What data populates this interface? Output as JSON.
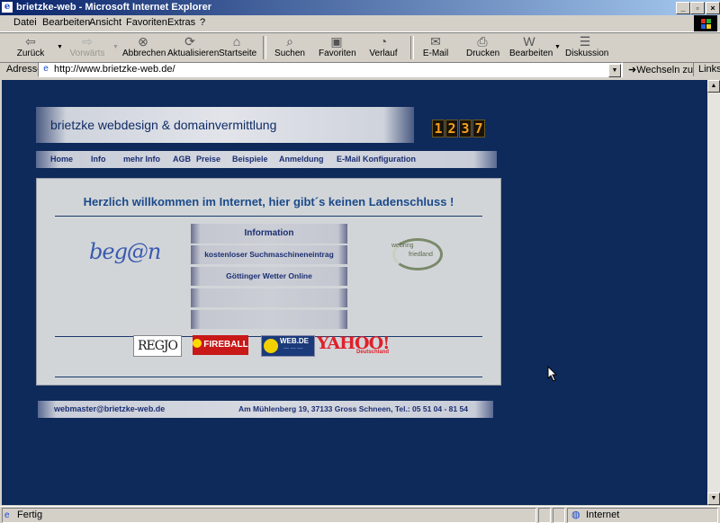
{
  "window": {
    "title": "brietzke-web - Microsoft Internet Explorer"
  },
  "menu": [
    "Datei",
    "Bearbeiten",
    "Ansicht",
    "Favoriten",
    "Extras",
    "?"
  ],
  "toolbar": {
    "back": "Zurück",
    "forward": "Vorwärts",
    "stop": "Abbrechen",
    "refresh": "Aktualisieren",
    "home": "Startseite",
    "search": "Suchen",
    "favorites": "Favoriten",
    "history": "Verlauf",
    "mail": "E-Mail",
    "print": "Drucken",
    "edit": "Bearbeiten",
    "discuss": "Diskussion"
  },
  "address": {
    "label": "Adresse",
    "url": "http://www.brietzke-web.de/",
    "go": "Wechseln zu",
    "links": "Links"
  },
  "site": {
    "header": "brietzke webdesign & domainvermittlung",
    "counter": [
      "1",
      "2",
      "3",
      "7"
    ],
    "nav": [
      "Home",
      "Info",
      "mehr Info",
      "AGB",
      "Preise",
      "Beispiele",
      "Anmeldung",
      "E-Mail Konfiguration"
    ],
    "welcome": "Herzlich willkommen im Internet, hier gibt´s keinen Ladenschluss !",
    "logo_left": "beg@n",
    "webring": {
      "line1": "webring",
      "line2": "friedland"
    },
    "info_buttons": [
      "Information",
      "kostenloser Suchmaschineneintrag",
      "Göttinger Wetter Online",
      "",
      ""
    ],
    "partners": {
      "regjo": "REGJO",
      "fireball": "FIREBALL",
      "webde": "WEB.DE",
      "yahoo": "YAHOO!",
      "yahoo_sub": "Deutschland"
    },
    "footer": {
      "email": "webmaster@brietzke-web.de",
      "address": "Am Mühlenberg 19, 37133 Gross Schneen, Tel.: 05 51 04 - 81 54"
    }
  },
  "status": {
    "text": "Fertig",
    "zone": "Internet"
  }
}
